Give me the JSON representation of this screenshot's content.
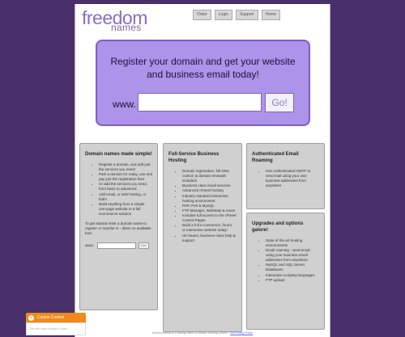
{
  "brand": {
    "word1": "freedom",
    "word2": "names"
  },
  "topnav": [
    "Order",
    "Login",
    "Support",
    "Home"
  ],
  "hero": {
    "headline_line1": "Register your domain and get your website",
    "headline_line2": "and business email today!",
    "www_label": "www.",
    "domain_value": "",
    "go_label": "Go!"
  },
  "col1": {
    "title": "Domain names made simple!",
    "items": [
      "Register a domain, and add just the services you need!",
      "Park a domain for today, use and pay just the registration fees",
      "Or add the services you need, from basic to advanced",
      "Add email, or web hosting, or both!",
      "Build anything from a simple one-page website to a full ecommerce solution"
    ],
    "note": "To get started enter a domain name to register or transfer in - direct us available box!",
    "mini_label": "www.",
    "mini_button": "Go!"
  },
  "col2": {
    "title": "Full-Service Business Hosting",
    "items": [
      "Domain registration, full DNS control, & domain renewals included!",
      "Business class email services",
      "Advanced cPanel hosting",
      "Industry standard interactive hosting environment",
      "PHP, Perl & MySQL",
      "FTP Manager, Webstats & more!",
      "Includes full access to the cPanel Control Pages",
      "Build a full e-commerce, forum, or interactive website today!",
      "UK based, business-class help & support"
    ]
  },
  "col3a": {
    "title": "Authenticated Email Roaming",
    "items": [
      "Use Authenticated SMTP to send mail using your own business addresses from anywhere"
    ]
  },
  "col3b": {
    "title": "Upgrades and options galore!",
    "items": [
      "State of the art hosting environments",
      "Email roaming - send email using your business email addresses from anywhere",
      "MySQL and SQL Server Databases",
      "Interactive scripting languages",
      "FTP upload"
    ]
  },
  "footer": {
    "text": "freedomnames is a trading name of Webtec Hosting Limited ·",
    "link": "our Privacy Policy"
  },
  "cookie": {
    "title": "Cookie Control",
    "body": "This site uses cookies to store"
  },
  "colors": {
    "background": "#49306b",
    "hero": "#ad93ea",
    "accent": "#f08a1c"
  }
}
